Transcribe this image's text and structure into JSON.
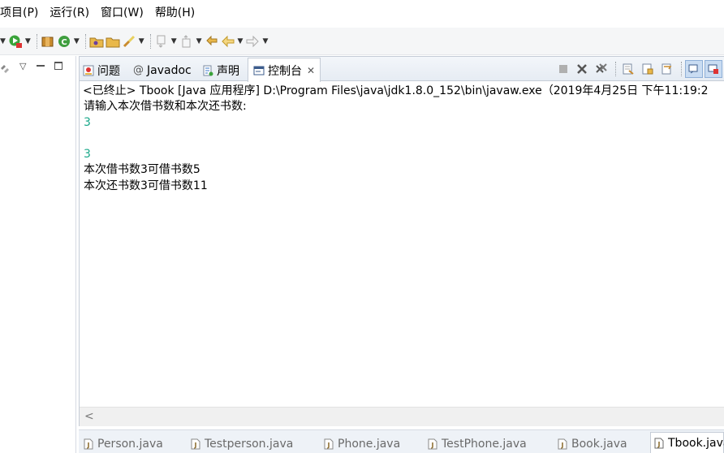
{
  "menu": {
    "items": [
      {
        "label": "项目(P)"
      },
      {
        "label": "运行(R)"
      },
      {
        "label": "窗口(W)"
      },
      {
        "label": "帮助(H)"
      }
    ]
  },
  "view_tabs": [
    {
      "label": "问题",
      "icon": "problems-icon"
    },
    {
      "label": "Javadoc",
      "icon": "at-icon"
    },
    {
      "label": "声明",
      "icon": "declaration-icon"
    },
    {
      "label": "控制台",
      "icon": "console-icon",
      "active": true
    }
  ],
  "console": {
    "header": "<已终止> Tbook [Java 应用程序] D:\\Program Files\\java\\jdk1.8.0_152\\bin\\javaw.exe（2019年4月25日 下午11:19:2",
    "lines": [
      {
        "text": "请输入本次借书数和本次还书数:",
        "type": "output"
      },
      {
        "text": "3",
        "type": "user"
      },
      {
        "text": "",
        "type": "output"
      },
      {
        "text": "3",
        "type": "user"
      },
      {
        "text": "本次借书数3可借书数5",
        "type": "output"
      },
      {
        "text": "本次还书数3可借书数11",
        "type": "output"
      }
    ]
  },
  "editor_tabs": [
    {
      "label": "Person.java"
    },
    {
      "label": "Testperson.java"
    },
    {
      "label": "Phone.java"
    },
    {
      "label": "TestPhone.java"
    },
    {
      "label": "Book.java"
    },
    {
      "label": "Tbook.java",
      "active": true
    }
  ],
  "colors": {
    "user_input": "#1aa88a",
    "accent": "#3c78c8"
  }
}
